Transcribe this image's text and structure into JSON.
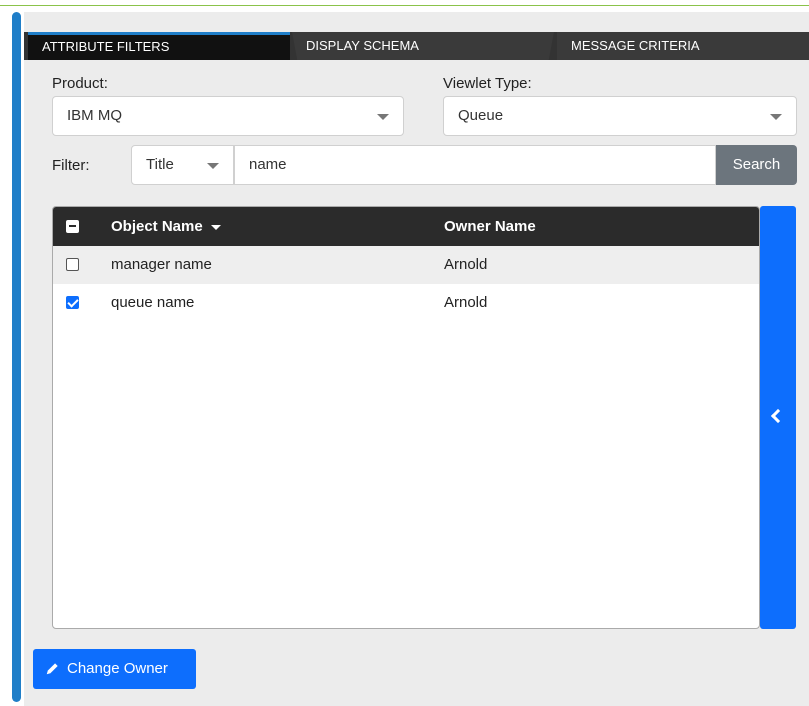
{
  "tabs": {
    "attribute_filters": "ATTRIBUTE FILTERS",
    "display_schema": "DISPLAY SCHEMA",
    "message_criteria": "MESSAGE CRITERIA"
  },
  "product": {
    "label": "Product:",
    "value": "IBM MQ"
  },
  "viewlet_type": {
    "label": "Viewlet Type:",
    "value": "Queue"
  },
  "filter": {
    "label": "Filter:",
    "field": "Title",
    "query": "name",
    "search_label": "Search"
  },
  "table": {
    "columns": {
      "object_name": "Object Name",
      "owner_name": "Owner Name"
    },
    "rows": [
      {
        "object_name": "manager name",
        "owner_name": "Arnold",
        "checked": false
      },
      {
        "object_name": "queue name",
        "owner_name": "Arnold",
        "checked": true
      }
    ]
  },
  "actions": {
    "change_owner": "Change Owner"
  },
  "icons": {
    "side_toggle": "chevron-left-icon",
    "change_owner": "pencil-icon"
  },
  "colors": {
    "accent": "#0d6efd",
    "tab_accent": "#1f7ec8",
    "header": "#2b2b2b"
  }
}
